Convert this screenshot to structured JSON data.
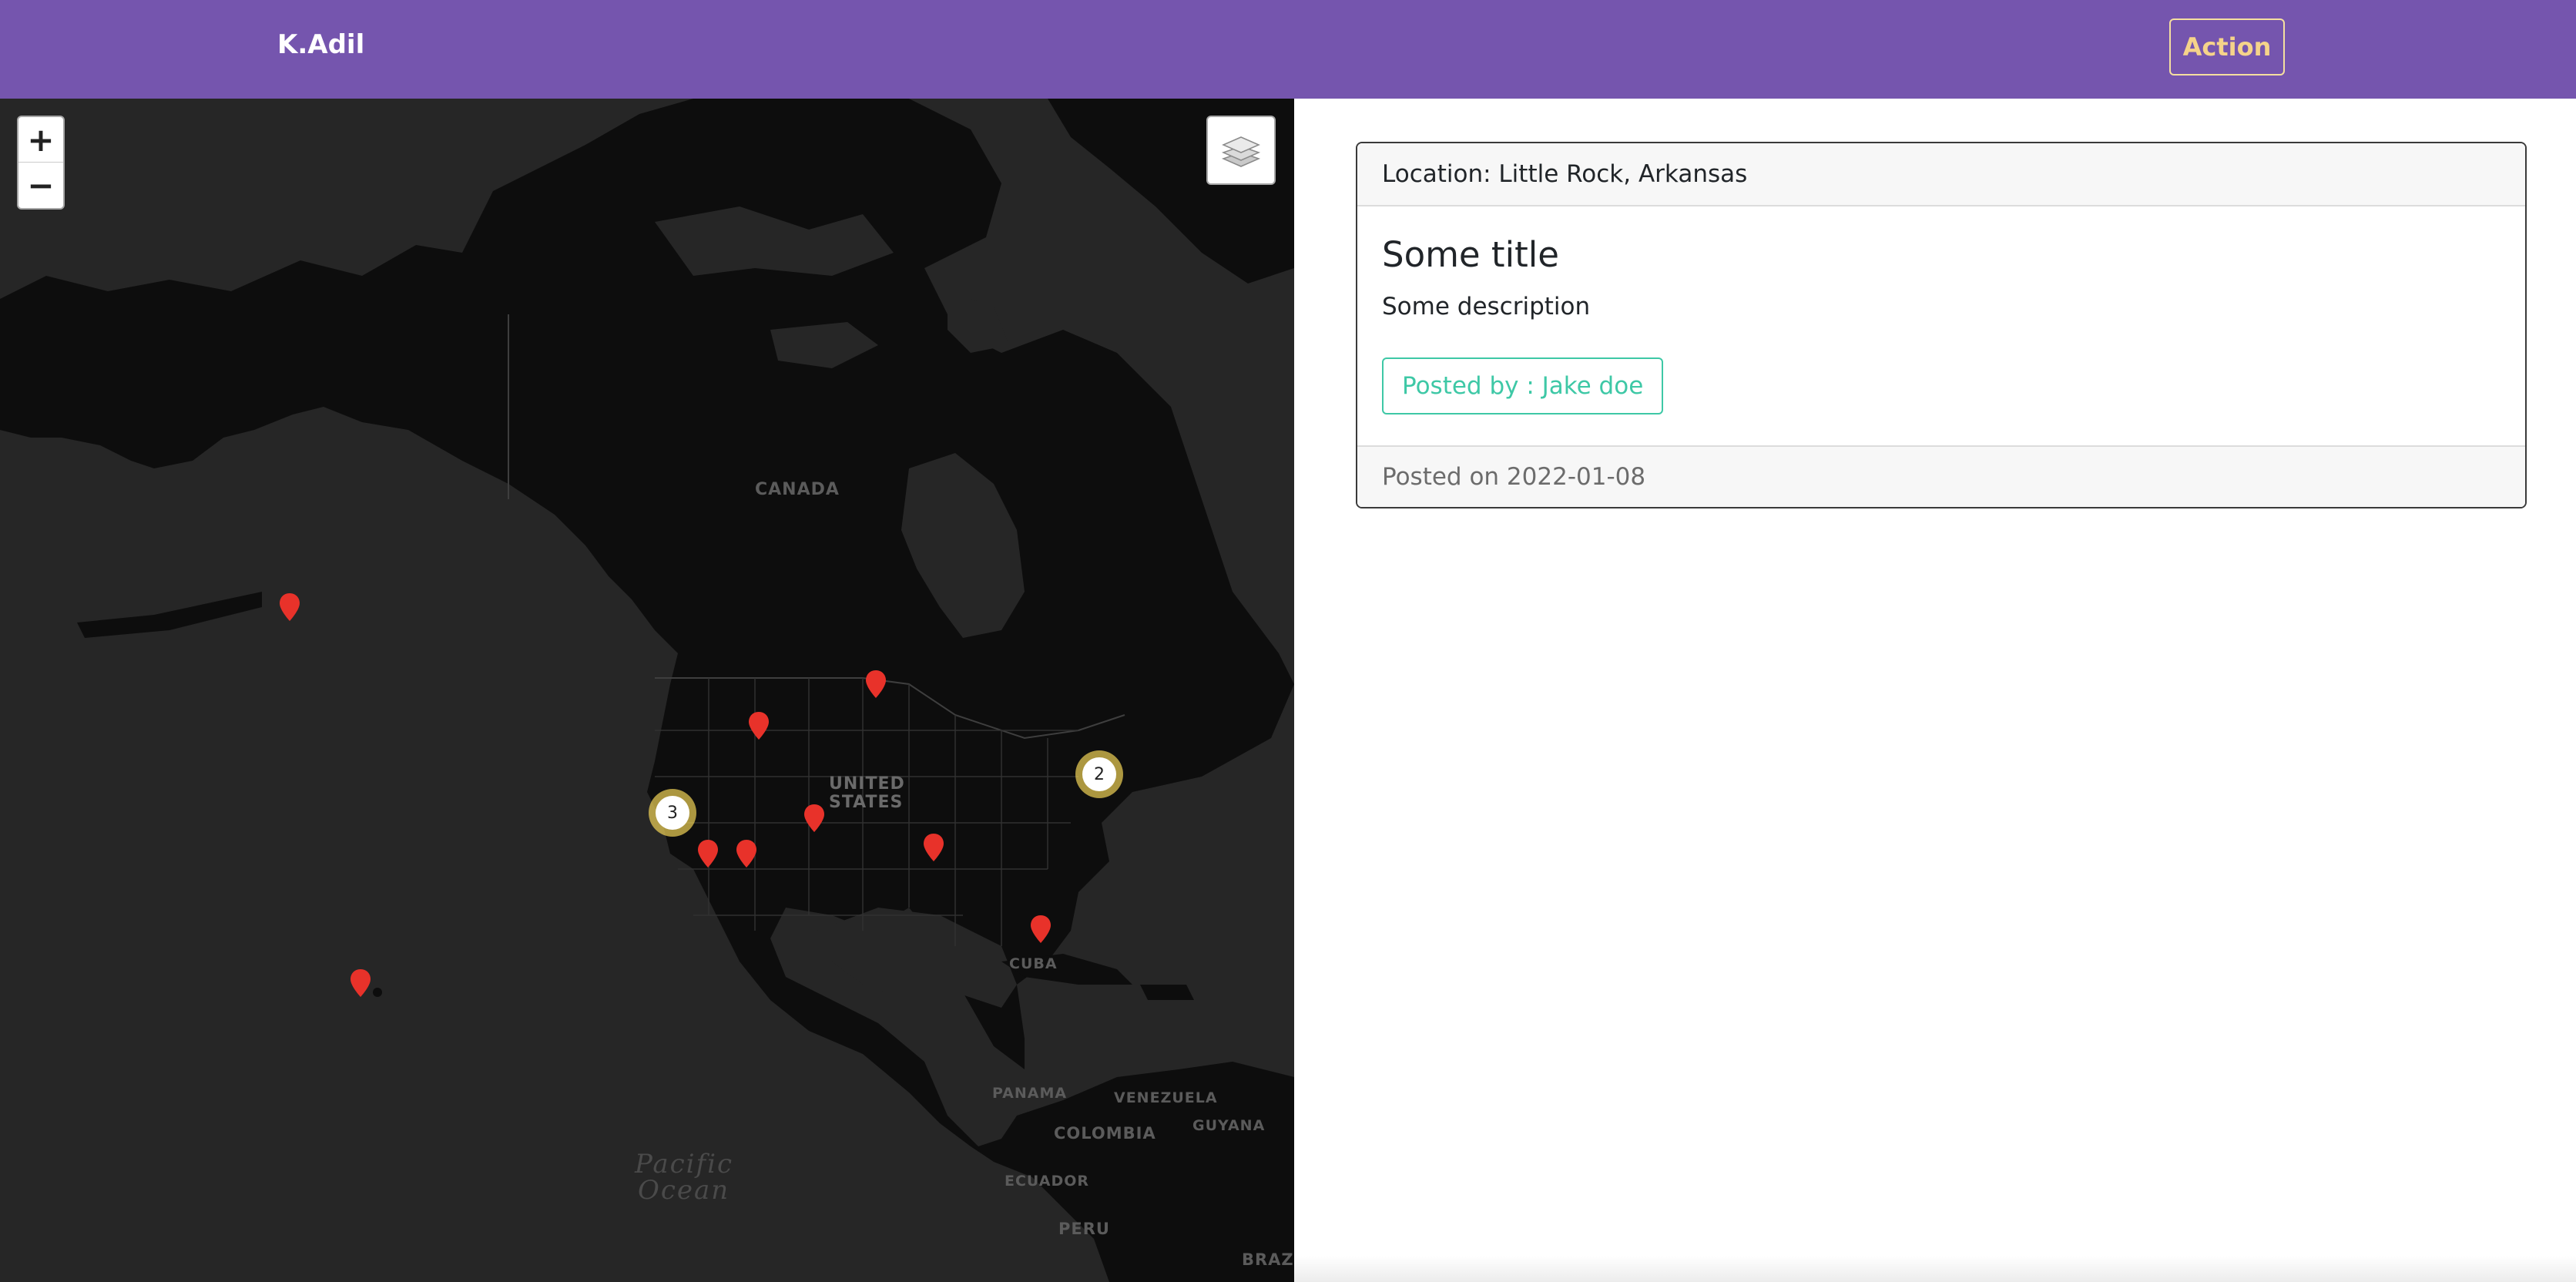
{
  "navbar": {
    "brand": "K.Adil",
    "action_label": "Action",
    "background": "#7555ae",
    "action_color": "#f5d38a"
  },
  "map": {
    "zoom_in_label": "+",
    "zoom_out_label": "−",
    "layers_icon": "layers-icon",
    "labels": {
      "canada": "CANADA",
      "united_states_1": "UNITED",
      "united_states_2": "STATES",
      "cuba": "CUBA",
      "panama": "PANAMA",
      "venezuela": "VENEZUELA",
      "colombia": "COLOMBIA",
      "guyana": "GUYANA",
      "ecuador": "ECUADOR",
      "peru": "PERU",
      "brazil": "BRAZ",
      "pacific_1": "Pacific",
      "pacific_2": "Ocean"
    },
    "marker_color": "#e8322a",
    "clusters": [
      {
        "count": "3"
      },
      {
        "count": "2"
      }
    ]
  },
  "card": {
    "header": "Location: Little Rock, Arkansas",
    "title": "Some title",
    "description": "Some description",
    "posted_by": "Posted by : Jake doe",
    "footer": "Posted on 2022-01-08",
    "accent": "#3ec8a6"
  }
}
